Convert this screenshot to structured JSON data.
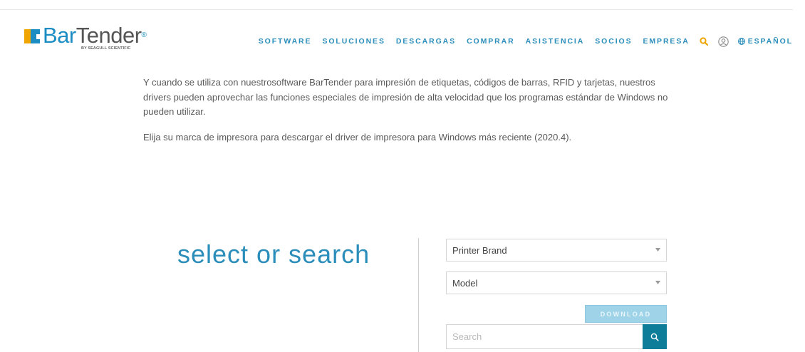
{
  "colors": {
    "accent": "#2a8dba",
    "nav_search_icon": "#f0a500",
    "search_button": "#0d7d99",
    "download_button": "#9fd3e8"
  },
  "logo": {
    "bar": "Bar",
    "tender": "Tender",
    "reg": "®",
    "subtitle": "BY SEAGULL SCIENTIFIC"
  },
  "nav": {
    "items": [
      "SOFTWARE",
      "SOLUCIONES",
      "DESCARGAS",
      "COMPRAR",
      "ASISTENCIA",
      "SOCIOS",
      "EMPRESA"
    ],
    "icons": [
      "search-icon",
      "user-icon",
      "globe-icon"
    ],
    "language": "ESPAÑOL"
  },
  "intro": {
    "paragraph1": "Y cuando se utiliza con nuestrosoftware BarTender para impresión de etiquetas, códigos de barras, RFID y tarjetas, nuestros drivers pueden aprovechar las funciones especiales de impresión de alta velocidad que los programas estándar de Windows no pueden utilizar.",
    "paragraph2": "Elija su marca de impresora para descargar el driver de impresora para Windows más reciente (2020.4)."
  },
  "finder": {
    "headline": "select or search",
    "brand_select": "Printer Brand",
    "model_select": "Model",
    "download_label": "DOWNLOAD",
    "search_placeholder": "Search"
  }
}
